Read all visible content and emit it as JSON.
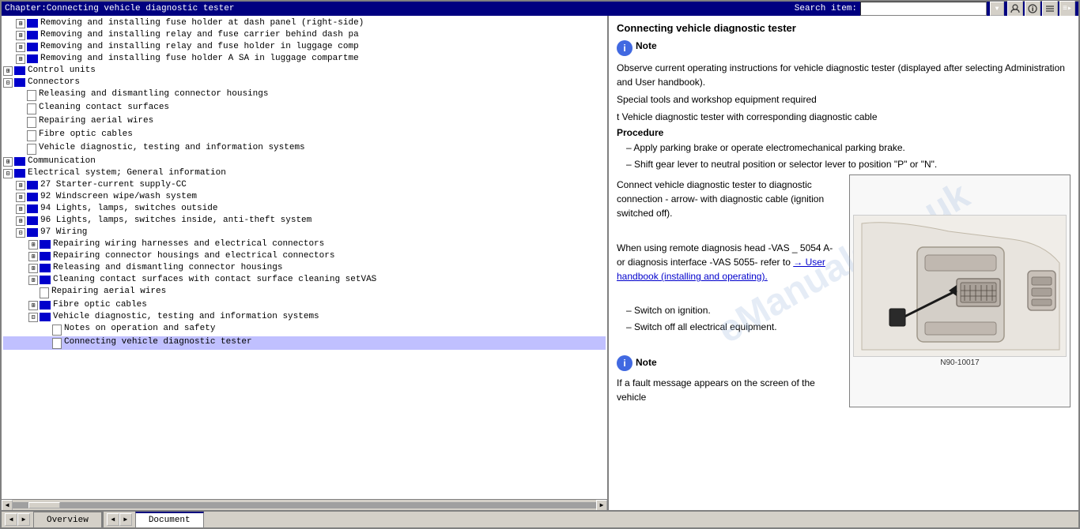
{
  "window": {
    "title": "Chapter:Connecting vehicle diagnostic tester"
  },
  "toolbar": {
    "search_label": "Search item:",
    "search_placeholder": "",
    "btn_user": "👤",
    "btn_info": "ℹ",
    "btn_menu": "≡"
  },
  "tree": {
    "items": [
      {
        "id": 1,
        "indent": 1,
        "type": "folder-expand",
        "label": "Removing and installing fuse holder at dash panel (right-side)"
      },
      {
        "id": 2,
        "indent": 1,
        "type": "folder-expand",
        "label": "Removing and installing relay and fuse carrier behind dash pa"
      },
      {
        "id": 3,
        "indent": 1,
        "type": "folder-expand",
        "label": "Removing and installing relay and fuse holder in luggage comp"
      },
      {
        "id": 4,
        "indent": 1,
        "type": "folder-expand",
        "label": "Removing and installing fuse holder A SA in luggage compartme"
      },
      {
        "id": 5,
        "indent": 0,
        "type": "folder-expand",
        "label": "Control units"
      },
      {
        "id": 6,
        "indent": 0,
        "type": "folder-expand",
        "label": "Connectors"
      },
      {
        "id": 7,
        "indent": 1,
        "type": "doc",
        "label": "Releasing and dismantling connector housings"
      },
      {
        "id": 8,
        "indent": 1,
        "type": "doc",
        "label": "Cleaning contact surfaces"
      },
      {
        "id": 9,
        "indent": 1,
        "type": "doc",
        "label": "Repairing aerial wires"
      },
      {
        "id": 10,
        "indent": 1,
        "type": "doc",
        "label": "Fibre optic cables"
      },
      {
        "id": 11,
        "indent": 1,
        "type": "doc",
        "label": "Vehicle diagnostic, testing and information systems"
      },
      {
        "id": 12,
        "indent": 0,
        "type": "folder-expand",
        "label": "Communication"
      },
      {
        "id": 13,
        "indent": 0,
        "type": "folder-expand",
        "label": "Electrical system; General information"
      },
      {
        "id": 14,
        "indent": 1,
        "type": "folder-expand",
        "label": "27 Starter-current supply-CC"
      },
      {
        "id": 15,
        "indent": 1,
        "type": "folder-expand",
        "label": "92 Windscreen wipe/wash system"
      },
      {
        "id": 16,
        "indent": 1,
        "type": "folder-expand",
        "label": "94 Lights, lamps, switches outside"
      },
      {
        "id": 17,
        "indent": 1,
        "type": "folder-expand",
        "label": "96 Lights, lamps, switches inside, anti-theft system"
      },
      {
        "id": 18,
        "indent": 1,
        "type": "folder-expand",
        "label": "97 Wiring"
      },
      {
        "id": 19,
        "indent": 2,
        "type": "folder-expand",
        "label": "Repairing wiring harnesses and electrical connectors"
      },
      {
        "id": 20,
        "indent": 2,
        "type": "folder-expand",
        "label": "Repairing connector housings and electrical connectors"
      },
      {
        "id": 21,
        "indent": 2,
        "type": "folder-expand",
        "label": "Releasing and dismantling connector housings"
      },
      {
        "id": 22,
        "indent": 2,
        "type": "folder-expand",
        "label": "Cleaning contact surfaces with contact surface cleaning setVAS"
      },
      {
        "id": 23,
        "indent": 2,
        "type": "doc",
        "label": "Repairing aerial wires"
      },
      {
        "id": 24,
        "indent": 2,
        "type": "folder-expand",
        "label": "Fibre optic cables"
      },
      {
        "id": 25,
        "indent": 2,
        "type": "folder-expand",
        "label": "Vehicle diagnostic, testing and information systems"
      },
      {
        "id": 26,
        "indent": 3,
        "type": "doc",
        "label": "Notes on operation and safety"
      },
      {
        "id": 27,
        "indent": 3,
        "type": "doc",
        "label": "Connecting vehicle diagnostic tester"
      }
    ]
  },
  "right": {
    "title": "Connecting vehicle diagnostic tester",
    "note_label": "Note",
    "note_text": "Observe current operating instructions for vehicle diagnostic tester (displayed after selecting Administration and User handbook).",
    "special_tools": "Special tools and workshop equipment required",
    "tool_item": "t  Vehicle diagnostic tester with corresponding diagnostic cable",
    "procedure_label": "Procedure",
    "steps": [
      "Apply parking brake or operate electromechanical parking brake.",
      "Shift gear lever to neutral position or selector lever to position \"P\" or \"N\"."
    ],
    "connect_text": "Connect vehicle diagnostic tester to diagnostic connection - arrow- with diagnostic cable (ignition switched off).",
    "remote_text": "When using remote diagnosis head -VAS _ 5054 A- or diagnosis interface -VAS 5055- refer to",
    "link_text": "→ User handbook (installing and operating).",
    "steps2": [
      "Switch on ignition.",
      "Switch off all electrical equipment."
    ],
    "note2_label": "Note",
    "note2_text": "If a fault message appears on the screen of the vehicle",
    "diagram_label": "N90-10017",
    "arrow_text": "arrow - With diagnostic"
  },
  "tabs_left": [
    {
      "label": "Overview",
      "active": false
    }
  ],
  "tabs_right": [
    {
      "label": "Document",
      "active": true
    }
  ]
}
